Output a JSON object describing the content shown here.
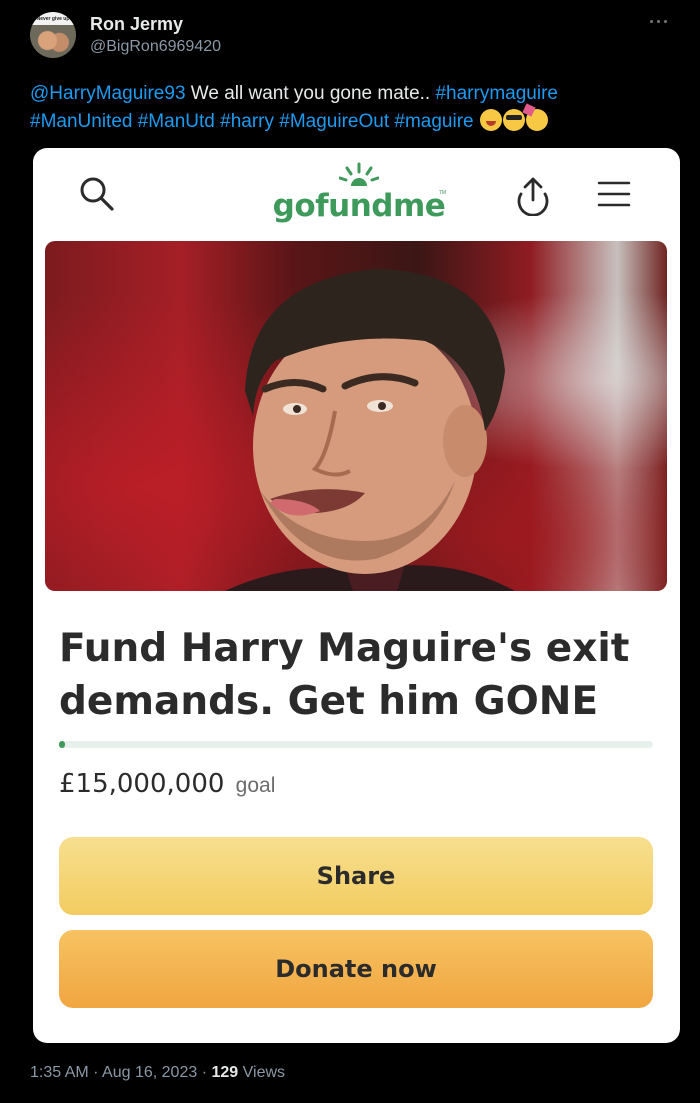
{
  "tweet": {
    "display_name": "Ron Jermy",
    "handle": "@BigRon6969420",
    "avatar_caption": "Never give up",
    "text_parts": {
      "mention": "@HarryMaguire93",
      "body": " We all want you gone mate.. ",
      "tag1": "#harrymaguire",
      "tag2": "#ManUnited",
      "tag3": "#ManUtd",
      "tag4": "#harry",
      "tag5": "#MaguireOut",
      "tag6": "#maguire"
    },
    "emojis": [
      "face-with-tears-of-joy",
      "smiling-face-with-sunglasses",
      "partying-face"
    ],
    "time": "1:35 AM",
    "separator": "·",
    "date": "Aug 16, 2023",
    "views_count": "129",
    "views_label": "Views"
  },
  "gofundme": {
    "logo_text": "gofundme",
    "logo_tm": "TM",
    "campaign_title": "Fund Harry Maguire's exit demands. Get him GONE",
    "progress_percent": 0,
    "goal_amount": "£15,000,000",
    "goal_label": "goal",
    "share_label": "Share",
    "donate_label": "Donate now"
  },
  "colors": {
    "background": "#000000",
    "link": "#1d9bf0",
    "brand_green": "#3d9a5b",
    "share_button": "#f2cc60",
    "donate_button": "#f0a640"
  }
}
